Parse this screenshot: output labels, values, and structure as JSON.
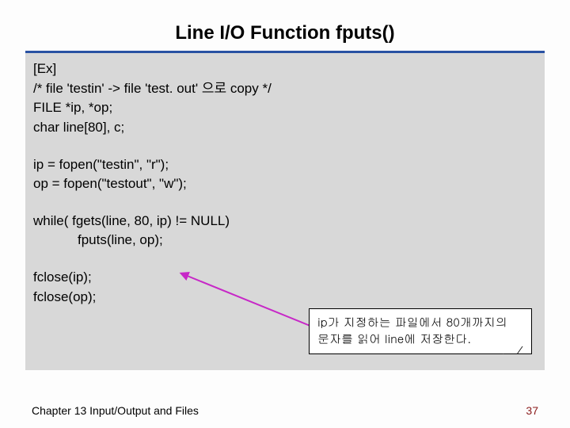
{
  "title": "Line I/O Function fputs()",
  "code": {
    "l1": "[Ex]",
    "l2": "/* file 'testin' -> file 'test. out' 으로 copy */",
    "l3": "FILE *ip, *op;",
    "l4": "char line[80], c;",
    "l5": "ip = fopen(\"testin\", \"r\");",
    "l6": "op = fopen(\"testout\", \"w\");",
    "l7": "while( fgets(line, 80, ip) != NULL)",
    "l8": "fputs(line, op);",
    "l9": "fclose(ip);",
    "l10": "fclose(op);"
  },
  "callout": {
    "line1": "ip가 지정하는 파일에서 80개까지의",
    "line2": "문자를 읽어 line에 저장한다."
  },
  "footer": {
    "chapter": "Chapter 13  Input/Output and Files",
    "page": "37"
  },
  "colors": {
    "rule": "#2952a3",
    "arrow": "#c728c7"
  }
}
